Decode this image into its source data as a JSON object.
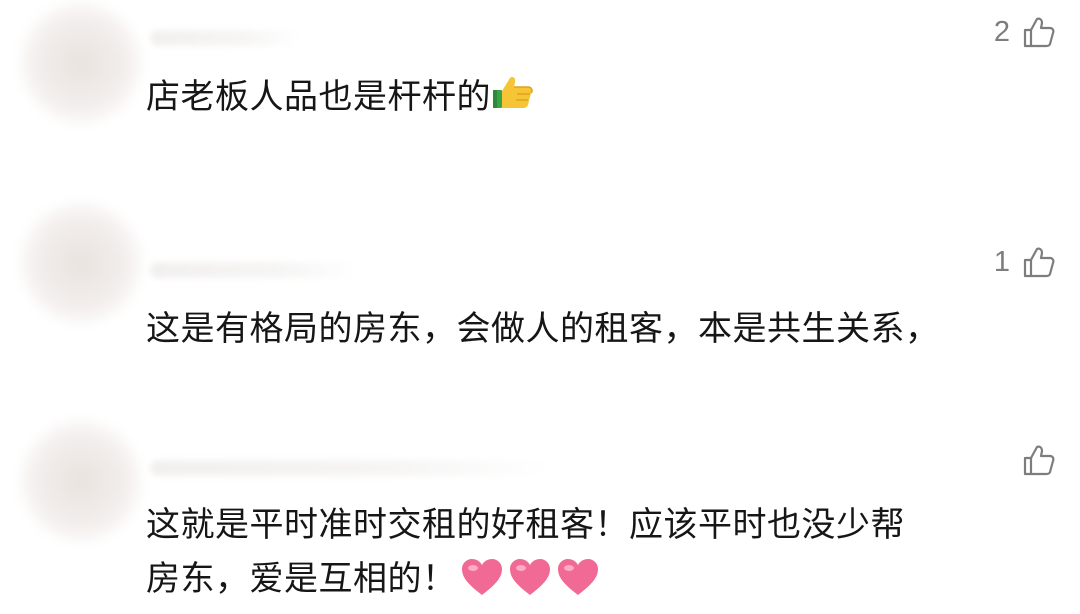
{
  "comments": [
    {
      "like_count": "2",
      "text": "店老板人品也是杆杆的",
      "emoji": "thumbs-up-emoji"
    },
    {
      "like_count": "1",
      "text": "这是有格局的房东，会做人的租客，本是共生关系，"
    },
    {
      "like_count": "",
      "text_line1": "这就是平时准时交租的好租客！应该平时也没少帮",
      "text_line2": "房东，爱是互相的！",
      "emoji": "pink-heart-emoji"
    }
  ],
  "colors": {
    "text": "#161616",
    "like_gray": "#7d7d7d",
    "heart_pink": "#f06a95"
  }
}
